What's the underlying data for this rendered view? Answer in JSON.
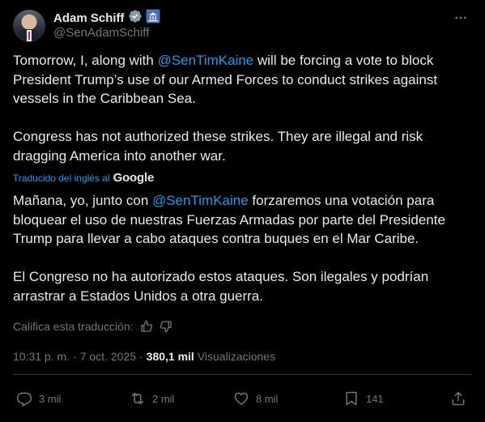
{
  "author": {
    "name": "Adam Schiff",
    "handle": "@SenAdamSchiff"
  },
  "tweet": {
    "para1_prefix": "Tomorrow, I, along with ",
    "para1_mention": "@SenTimKaine",
    "para1_suffix": " will be forcing a vote to block President Trump’s use of our Armed Forces to conduct strikes against vessels in the Caribbean Sea.",
    "para2": "Congress has not authorized these strikes. They are illegal and risk dragging America into another war."
  },
  "translation": {
    "label": "Traducido del inglés al",
    "provider": "Google",
    "para1_prefix": "Mañana, yo, junto con ",
    "para1_mention": "@SenTimKaine",
    "para1_suffix": " forzaremos una votación para bloquear el uso de nuestras Fuerzas Armadas por parte del Presidente Trump para llevar a cabo ataques contra buques en el Mar Caribe.",
    "para2": "El Congreso no ha autorizado estos ataques. Son ilegales y podrían arrastrar a Estados Unidos a otra guerra.",
    "rate_label": "Califica esta traducción:"
  },
  "meta": {
    "time": "10:31 p. m.",
    "separator": "·",
    "date": "7 oct. 2025",
    "views_count": "380,1 mil",
    "views_label": "Visualizaciones"
  },
  "actions": {
    "replies": "3 mil",
    "reposts": "2 mil",
    "likes": "8 mil",
    "bookmarks": "141"
  },
  "colors": {
    "accent": "#1d9bf0",
    "verified": "#829aab",
    "muted": "#71767b",
    "background": "#000000"
  },
  "icons": [
    "verified-badge-icon",
    "senate-affiliation-icon",
    "more-icon",
    "thumbs-up-icon",
    "thumbs-down-icon",
    "reply-icon",
    "repost-icon",
    "like-icon",
    "bookmark-icon",
    "share-icon"
  ]
}
